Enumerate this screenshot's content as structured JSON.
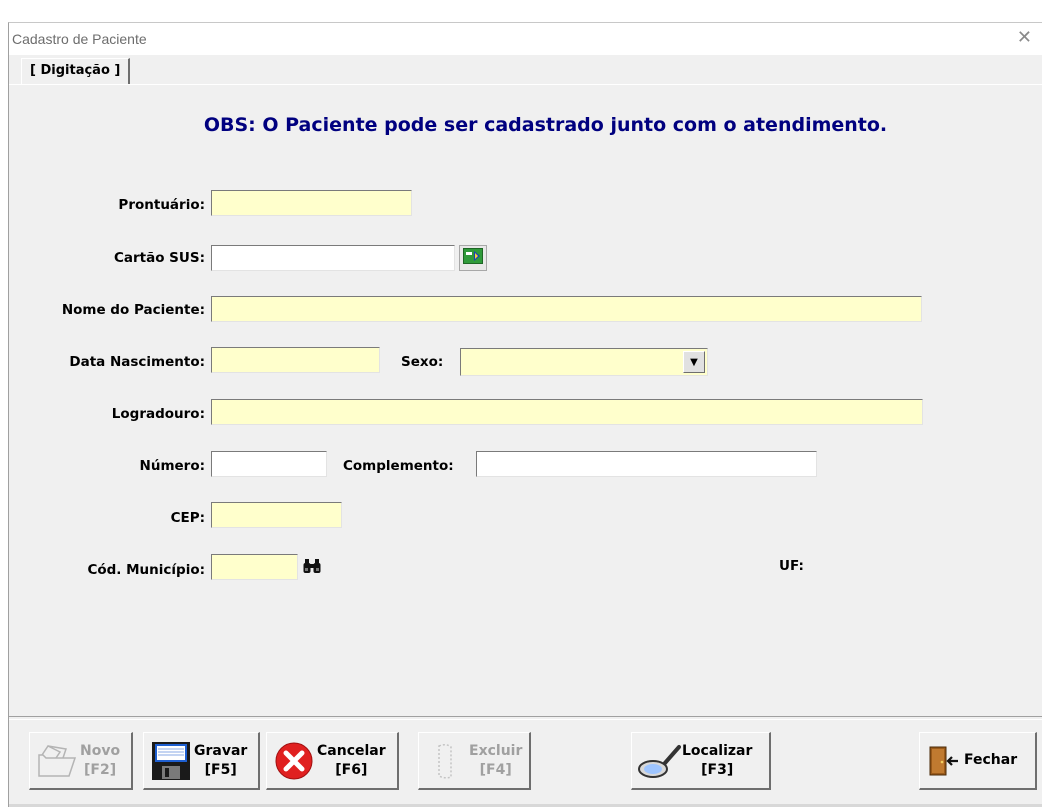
{
  "window": {
    "title": "Cadastro de Paciente",
    "close_glyph": "✕"
  },
  "tab": {
    "label": "[ Digitação ]"
  },
  "notice": "OBS: O Paciente pode ser cadastrado junto com o atendimento.",
  "form": {
    "prontuario": {
      "label": "Prontuário:",
      "value": ""
    },
    "cartao_sus": {
      "label": "Cartão SUS:",
      "value": "",
      "button_icon": "card-reader-icon"
    },
    "nome": {
      "label": "Nome do Paciente:",
      "value": ""
    },
    "data_nascimento": {
      "label": "Data Nascimento:",
      "value": ""
    },
    "sexo": {
      "label": "Sexo:",
      "value": "",
      "arrow_icon": "chevron-down-icon"
    },
    "logradouro": {
      "label": "Logradouro:",
      "value": ""
    },
    "numero": {
      "label": "Número:",
      "value": ""
    },
    "complemento": {
      "label": "Complemento:",
      "value": ""
    },
    "cep": {
      "label": "CEP:",
      "value": ""
    },
    "cod_municipio": {
      "label": "Cód. Município:",
      "value": "",
      "search_icon": "binoculars-icon"
    },
    "uf": {
      "label": "UF:"
    }
  },
  "toolbar": {
    "novo": {
      "label": "Novo",
      "key": "[F2]",
      "enabled": false,
      "icon": "folder-icon"
    },
    "gravar": {
      "label": "Gravar",
      "key": "[F5]",
      "enabled": true,
      "icon": "floppy-disk-icon"
    },
    "cancelar": {
      "label": "Cancelar",
      "key": "[F6]",
      "enabled": true,
      "icon": "cancel-icon"
    },
    "excluir": {
      "label": "Excluir",
      "key": "[F4]",
      "enabled": false,
      "icon": "delete-icon"
    },
    "localizar": {
      "label": "Localizar",
      "key": "[F3]",
      "enabled": true,
      "icon": "magnifier-icon"
    },
    "fechar": {
      "label": "Fechar",
      "enabled": true,
      "icon": "exit-door-icon"
    }
  },
  "colors": {
    "required_field": "#ffffcc",
    "notice_text": "#00007f",
    "cancel_red": "#e02020"
  }
}
